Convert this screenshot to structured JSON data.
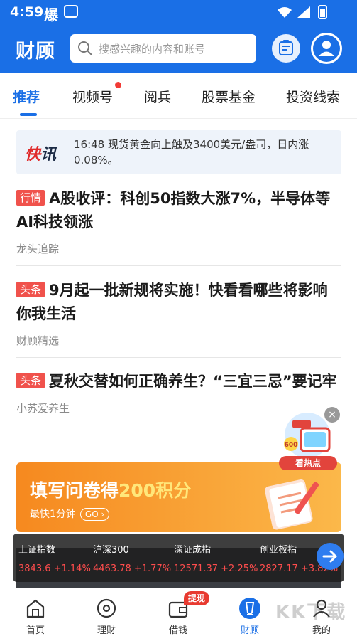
{
  "status_bar": {
    "time": "4:59",
    "indicator": "爆"
  },
  "header": {
    "logo": "财顾",
    "search_placeholder": "搜感兴趣的内容和账号"
  },
  "tabs": [
    {
      "label": "推荐",
      "active": true
    },
    {
      "label": "视频号",
      "has_dot": true
    },
    {
      "label": "阅兵"
    },
    {
      "label": "股票基金"
    },
    {
      "label": "投资线索"
    }
  ],
  "flash": {
    "badge_left": "快",
    "badge_right": "讯",
    "text": "16:48  现货黄金向上触及3400美元/盎司，日内涨0.08%。"
  },
  "articles": [
    {
      "tag": "行情",
      "title": "A股收评：科创50指数大涨7%，半导体等AI科技领涨",
      "source": "龙头追踪"
    },
    {
      "tag": "头条",
      "title": "9月起一批新规将实施！快看看哪些将影响你我生活",
      "source": "财顾精选"
    },
    {
      "tag": "头条",
      "title": "夏秋交替如何正确养生？“三宜三忌”要记牢",
      "source": "小苏爱养生"
    }
  ],
  "banner": {
    "title_prefix": "填写问卷得",
    "title_highlight": "200积分",
    "subtitle": "最快1分钟",
    "go": "GO"
  },
  "promo": {
    "badge": "600",
    "label": "看热点",
    "close": "×"
  },
  "ticker": [
    {
      "name": "上证指数",
      "value": "3843.6 +1.14%"
    },
    {
      "name": "沪深300",
      "value": "4463.78 +1.77%"
    },
    {
      "name": "深证成指",
      "value": "12571.37 +2.25%"
    },
    {
      "name": "创业板指",
      "value": "2827.17 +3.82%"
    }
  ],
  "bottom_nav": [
    {
      "label": "首页"
    },
    {
      "label": "理财"
    },
    {
      "label": "借钱",
      "badge": "提现"
    },
    {
      "label": "财顾",
      "active": true
    },
    {
      "label": "我的"
    }
  ],
  "watermark": "KK下载",
  "colors": {
    "brand_blue": "#1a6fe6",
    "tag_red": "#f0524c",
    "up_red": "#ff4d4d",
    "banner_orange": "#f6891f"
  }
}
